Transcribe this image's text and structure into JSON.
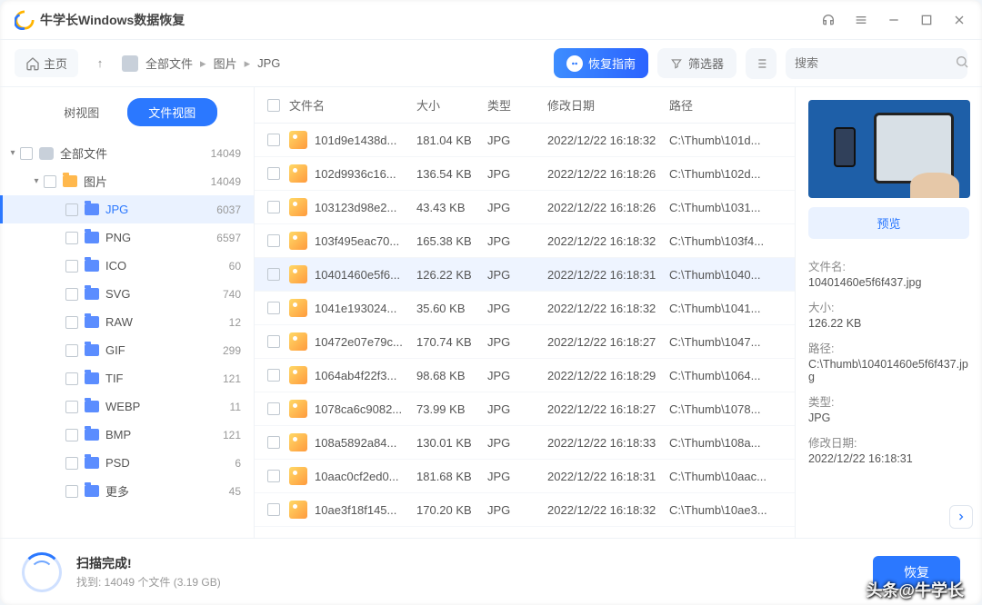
{
  "app": {
    "title": "牛学长Windows数据恢复"
  },
  "toolbar": {
    "home": "主页",
    "breadcrumb": [
      "全部文件",
      "图片",
      "JPG"
    ],
    "guide": "恢复指南",
    "filter": "筛选器",
    "search_placeholder": "搜索"
  },
  "sidebar": {
    "tabs": {
      "tree": "树视图",
      "file": "文件视图"
    },
    "root": {
      "label": "全部文件",
      "count": "14049"
    },
    "group": {
      "label": "图片",
      "count": "14049"
    },
    "items": [
      {
        "label": "JPG",
        "count": "6037"
      },
      {
        "label": "PNG",
        "count": "6597"
      },
      {
        "label": "ICO",
        "count": "60"
      },
      {
        "label": "SVG",
        "count": "740"
      },
      {
        "label": "RAW",
        "count": "12"
      },
      {
        "label": "GIF",
        "count": "299"
      },
      {
        "label": "TIF",
        "count": "121"
      },
      {
        "label": "WEBP",
        "count": "11"
      },
      {
        "label": "BMP",
        "count": "121"
      },
      {
        "label": "PSD",
        "count": "6"
      },
      {
        "label": "更多",
        "count": "45"
      }
    ]
  },
  "table": {
    "headers": {
      "name": "文件名",
      "size": "大小",
      "type": "类型",
      "date": "修改日期",
      "path": "路径"
    },
    "rows": [
      {
        "name": "101d9e1438d...",
        "size": "181.04 KB",
        "type": "JPG",
        "date": "2022/12/22 16:18:32",
        "path": "C:\\Thumb\\101d..."
      },
      {
        "name": "102d9936c16...",
        "size": "136.54 KB",
        "type": "JPG",
        "date": "2022/12/22 16:18:26",
        "path": "C:\\Thumb\\102d..."
      },
      {
        "name": "103123d98e2...",
        "size": "43.43 KB",
        "type": "JPG",
        "date": "2022/12/22 16:18:26",
        "path": "C:\\Thumb\\1031..."
      },
      {
        "name": "103f495eac70...",
        "size": "165.38 KB",
        "type": "JPG",
        "date": "2022/12/22 16:18:32",
        "path": "C:\\Thumb\\103f4..."
      },
      {
        "name": "10401460e5f6...",
        "size": "126.22 KB",
        "type": "JPG",
        "date": "2022/12/22 16:18:31",
        "path": "C:\\Thumb\\1040...",
        "sel": true
      },
      {
        "name": "1041e193024...",
        "size": "35.60 KB",
        "type": "JPG",
        "date": "2022/12/22 16:18:32",
        "path": "C:\\Thumb\\1041..."
      },
      {
        "name": "10472e07e79c...",
        "size": "170.74 KB",
        "type": "JPG",
        "date": "2022/12/22 16:18:27",
        "path": "C:\\Thumb\\1047..."
      },
      {
        "name": "1064ab4f22f3...",
        "size": "98.68 KB",
        "type": "JPG",
        "date": "2022/12/22 16:18:29",
        "path": "C:\\Thumb\\1064..."
      },
      {
        "name": "1078ca6c9082...",
        "size": "73.99 KB",
        "type": "JPG",
        "date": "2022/12/22 16:18:27",
        "path": "C:\\Thumb\\1078..."
      },
      {
        "name": "108a5892a84...",
        "size": "130.01 KB",
        "type": "JPG",
        "date": "2022/12/22 16:18:33",
        "path": "C:\\Thumb\\108a..."
      },
      {
        "name": "10aac0cf2ed0...",
        "size": "181.68 KB",
        "type": "JPG",
        "date": "2022/12/22 16:18:31",
        "path": "C:\\Thumb\\10aac..."
      },
      {
        "name": "10ae3f18f145...",
        "size": "170.20 KB",
        "type": "JPG",
        "date": "2022/12/22 16:18:32",
        "path": "C:\\Thumb\\10ae3..."
      }
    ]
  },
  "inspector": {
    "preview_btn": "预览",
    "labels": {
      "name": "文件名:",
      "size": "大小:",
      "path": "路径:",
      "type": "类型:",
      "date": "修改日期:"
    },
    "values": {
      "name": "10401460e5f6f437.jpg",
      "size": "126.22 KB",
      "path": "C:\\Thumb\\10401460e5f6f437.jpg",
      "type": "JPG",
      "date": "2022/12/22 16:18:31"
    }
  },
  "footer": {
    "title": "扫描完成!",
    "subtitle": "找到: 14049 个文件 (3.19 GB)",
    "recover": "恢复",
    "watermark": "头条@牛学长"
  }
}
